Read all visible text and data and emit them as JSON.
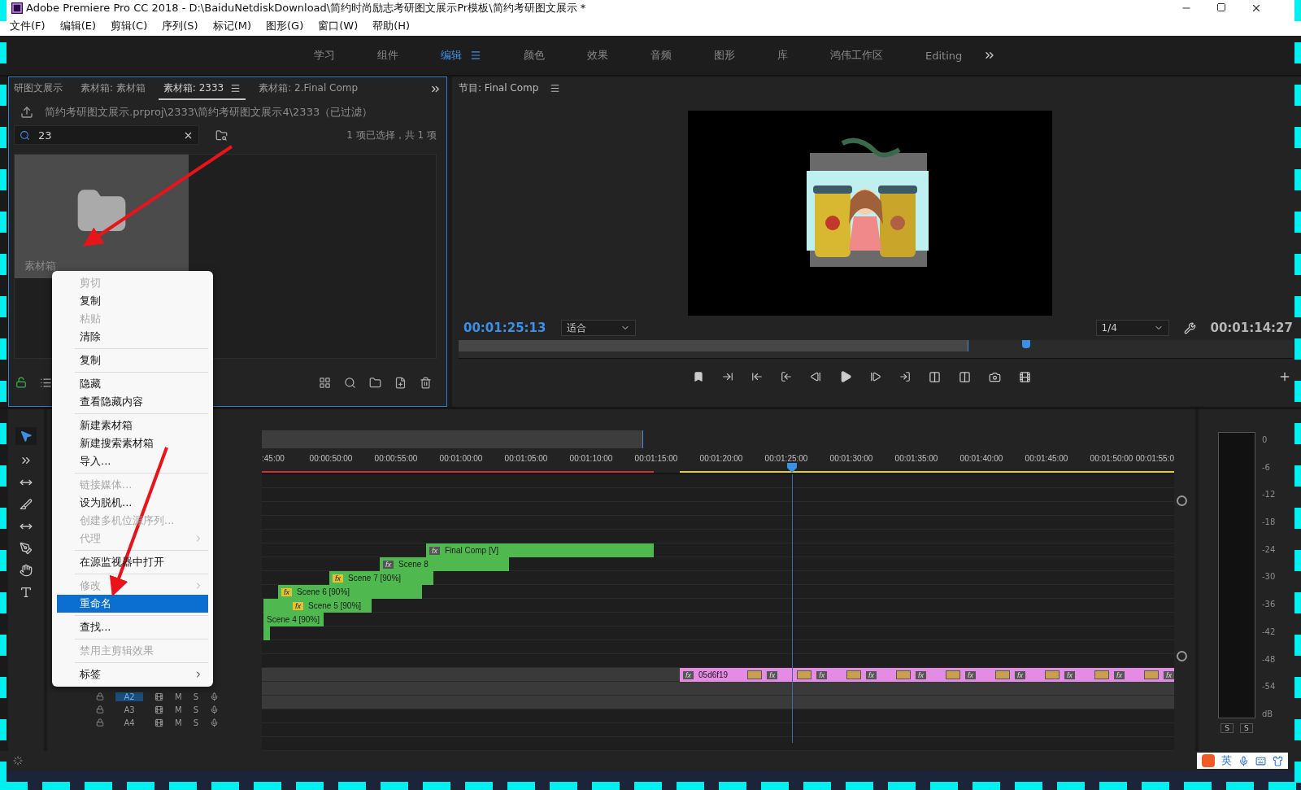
{
  "window": {
    "title": "Adobe Premiere Pro CC 2018 - D:\\BaiduNetdiskDownload\\简约时尚励志考研图文展示Pr模板\\简约考研图文展示 *"
  },
  "menu_bar": [
    "文件(F)",
    "编辑(E)",
    "剪辑(C)",
    "序列(S)",
    "标记(M)",
    "图形(G)",
    "窗口(W)",
    "帮助(H)"
  ],
  "workspaces": [
    {
      "label": "学习",
      "selected": false
    },
    {
      "label": "组件",
      "selected": false
    },
    {
      "label": "编辑",
      "selected": true
    },
    {
      "label": "颜色",
      "selected": false
    },
    {
      "label": "效果",
      "selected": false
    },
    {
      "label": "音频",
      "selected": false
    },
    {
      "label": "图形",
      "selected": false
    },
    {
      "label": "库",
      "selected": false
    },
    {
      "label": "鸿伟工作区",
      "selected": false
    },
    {
      "label": "Editing",
      "selected": false
    }
  ],
  "project_panel": {
    "tabs": [
      {
        "label": "研图文展示",
        "selected": false
      },
      {
        "label": "素材箱: 素材箱",
        "selected": false
      },
      {
        "label": "素材箱: 2333",
        "selected": true
      },
      {
        "label": "素材箱: 2.Final Comp",
        "selected": false
      }
    ],
    "path": "简约考研图文展示.prproj\\2333\\简约考研图文展示4\\2333（已过滤）",
    "search": {
      "value": "23"
    },
    "selection_info": "1 项已选择，共 1 项",
    "items": [
      {
        "name": "素材箱",
        "selected": true
      }
    ]
  },
  "context_menu": {
    "items": [
      {
        "kind": "item",
        "label": "剪切",
        "disabled": true,
        "selected": false,
        "submenu": false
      },
      {
        "kind": "item",
        "label": "复制",
        "disabled": false,
        "selected": false,
        "submenu": false
      },
      {
        "kind": "item",
        "label": "粘贴",
        "disabled": true,
        "selected": false,
        "submenu": false
      },
      {
        "kind": "item",
        "label": "清除",
        "disabled": false,
        "selected": false,
        "submenu": false
      },
      {
        "kind": "separator"
      },
      {
        "kind": "item",
        "label": "复制",
        "disabled": false,
        "selected": false,
        "submenu": false
      },
      {
        "kind": "separator"
      },
      {
        "kind": "item",
        "label": "隐藏",
        "disabled": false,
        "selected": false,
        "submenu": false
      },
      {
        "kind": "item",
        "label": "查看隐藏内容",
        "disabled": false,
        "selected": false,
        "submenu": false
      },
      {
        "kind": "separator"
      },
      {
        "kind": "item",
        "label": "新建素材箱",
        "disabled": false,
        "selected": false,
        "submenu": false
      },
      {
        "kind": "item",
        "label": "新建搜索素材箱",
        "disabled": false,
        "selected": false,
        "submenu": false
      },
      {
        "kind": "item",
        "label": "导入...",
        "disabled": false,
        "selected": false,
        "submenu": false
      },
      {
        "kind": "separator"
      },
      {
        "kind": "item",
        "label": "链接媒体...",
        "disabled": true,
        "selected": false,
        "submenu": false
      },
      {
        "kind": "item",
        "label": "设为脱机...",
        "disabled": false,
        "selected": false,
        "submenu": false
      },
      {
        "kind": "item",
        "label": "创建多机位源序列...",
        "disabled": true,
        "selected": false,
        "submenu": false
      },
      {
        "kind": "item",
        "label": "代理",
        "disabled": true,
        "selected": false,
        "submenu": true
      },
      {
        "kind": "separator"
      },
      {
        "kind": "item",
        "label": "在源监视器中打开",
        "disabled": false,
        "selected": false,
        "submenu": false
      },
      {
        "kind": "separator"
      },
      {
        "kind": "item",
        "label": "修改",
        "disabled": true,
        "selected": false,
        "submenu": true
      },
      {
        "kind": "item",
        "label": "重命名",
        "disabled": false,
        "selected": true,
        "submenu": false
      },
      {
        "kind": "separator"
      },
      {
        "kind": "item",
        "label": "查找...",
        "disabled": false,
        "selected": false,
        "submenu": false
      },
      {
        "kind": "separator"
      },
      {
        "kind": "item",
        "label": "禁用主剪辑效果",
        "disabled": true,
        "selected": false,
        "submenu": false
      },
      {
        "kind": "separator"
      },
      {
        "kind": "item",
        "label": "标签",
        "disabled": false,
        "selected": false,
        "submenu": true
      }
    ]
  },
  "program_monitor": {
    "title": "节目: Final Comp",
    "timecode": "00:01:25:13",
    "zoom": "适合",
    "resolution": "1/4",
    "duration": "00:01:14:27"
  },
  "timeline": {
    "ruler": [
      ":45:00",
      "00:00:50:00",
      "00:00:55:00",
      "00:01:00:00",
      "00:01:05:00",
      "00:01:10:00",
      "00:01:15:00",
      "00:01:20:00",
      "00:01:25:00",
      "00:01:30:00",
      "00:01:35:00",
      "00:01:40:00",
      "00:01:45:00",
      "00:01:50:00",
      "00:01:55:0"
    ],
    "clips": [
      {
        "label": "Final Comp [V]",
        "badges": [
          "fx"
        ],
        "modified": false,
        "color": "#4fb84f"
      },
      {
        "label": "Scene 8",
        "badges": [
          "fx"
        ],
        "modified": false,
        "color": "#4fb84f"
      },
      {
        "label": "Scene 7 [90%]",
        "badges": [
          "fx"
        ],
        "modified": true,
        "color": "#4fb84f"
      },
      {
        "label": "Scene 6 [90%]",
        "badges": [
          "fx"
        ],
        "modified": true,
        "color": "#4fb84f"
      },
      {
        "label": "Scene 5 [90%]",
        "badges": [
          "fx"
        ],
        "modified": true,
        "color": "#4fb84f"
      },
      {
        "label": "Scene 4 [90%]",
        "color": "#4fb84f"
      },
      {
        "label": "05d6f19",
        "badges": [
          "fx",
          "fx",
          "fx",
          "fx",
          "fx",
          "fx",
          "fx",
          "fx",
          "fx",
          "fx"
        ],
        "modified": false,
        "color": "#e48be4"
      }
    ],
    "tracks": [
      {
        "label": "A2",
        "selected": true,
        "mute": "M",
        "solo": "S"
      },
      {
        "label": "A3",
        "selected": false,
        "mute": "M",
        "solo": "S"
      },
      {
        "label": "A4",
        "selected": false,
        "mute": "M",
        "solo": "S"
      }
    ]
  },
  "audio_meter": {
    "scale": [
      "0",
      "-6",
      "-12",
      "-18",
      "-24",
      "-30",
      "-36",
      "-42",
      "-48",
      "-54",
      "dB"
    ],
    "solo_buttons": [
      "S",
      "S"
    ]
  },
  "taskbar": {
    "ime_mode": "英"
  }
}
